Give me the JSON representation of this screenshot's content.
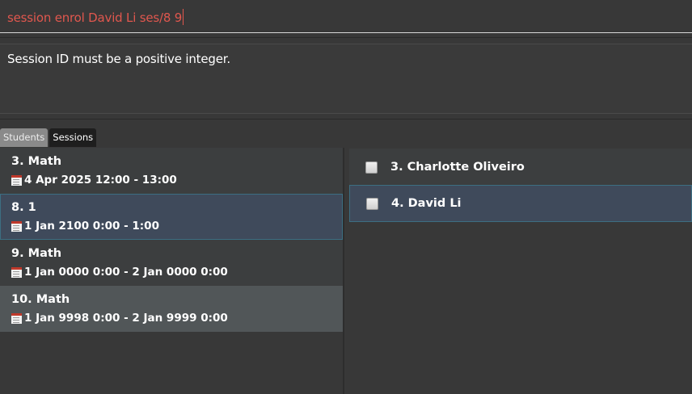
{
  "command": {
    "value": "session enrol David Li ses/8 9"
  },
  "result": {
    "message": "Session ID must be a positive integer."
  },
  "tabs": [
    {
      "label": "Students",
      "active": false
    },
    {
      "label": "Sessions",
      "active": true
    }
  ],
  "sessions": [
    {
      "title": "3. Math",
      "time": "4 Apr 2025 12:00 - 13:00",
      "selected": false
    },
    {
      "title": "8. 1",
      "time": "1 Jan 2100 0:00 - 1:00",
      "selected": true
    },
    {
      "title": "9. Math",
      "time": "1 Jan 0000 0:00 - 2 Jan 0000 0:00",
      "selected": false
    },
    {
      "title": "10. Math",
      "time": "1 Jan 9998 0:00 - 2 Jan 9999 0:00",
      "selected": false
    }
  ],
  "students": [
    {
      "label": "3. Charlotte Oliveiro",
      "checked": false,
      "selected": false
    },
    {
      "label": "4. David Li",
      "checked": false,
      "selected": true
    }
  ],
  "icons": {
    "calendar": "calendar-icon",
    "checkbox": "checkbox"
  },
  "colors": {
    "command_text": "#e0574e",
    "selected_bg": "#3f4a5b",
    "selected_border": "#3c6e82"
  }
}
